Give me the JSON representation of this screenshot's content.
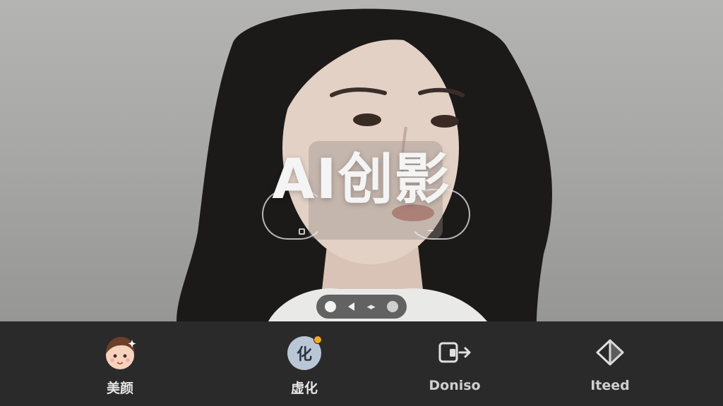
{
  "overlay": {
    "title": "AI创影"
  },
  "pager": {
    "active_index": 0
  },
  "toolbar": {
    "items": [
      {
        "label": "美颜",
        "icon": "face-avatar-icon",
        "active": false
      },
      {
        "label": "虚化",
        "icon": "blur-icon",
        "badge": "化",
        "notification": true,
        "active": true
      },
      {
        "label": "Doniso",
        "icon": "export-arrow-icon",
        "active": false
      },
      {
        "label": "Iteed",
        "icon": "diamond-icon",
        "active": false
      }
    ]
  },
  "colors": {
    "toolbar_bg": "#2a2a2a",
    "label_text": "#e6e6e6",
    "notification_dot": "#f5a623",
    "blur_badge": "#b9c6d6"
  }
}
